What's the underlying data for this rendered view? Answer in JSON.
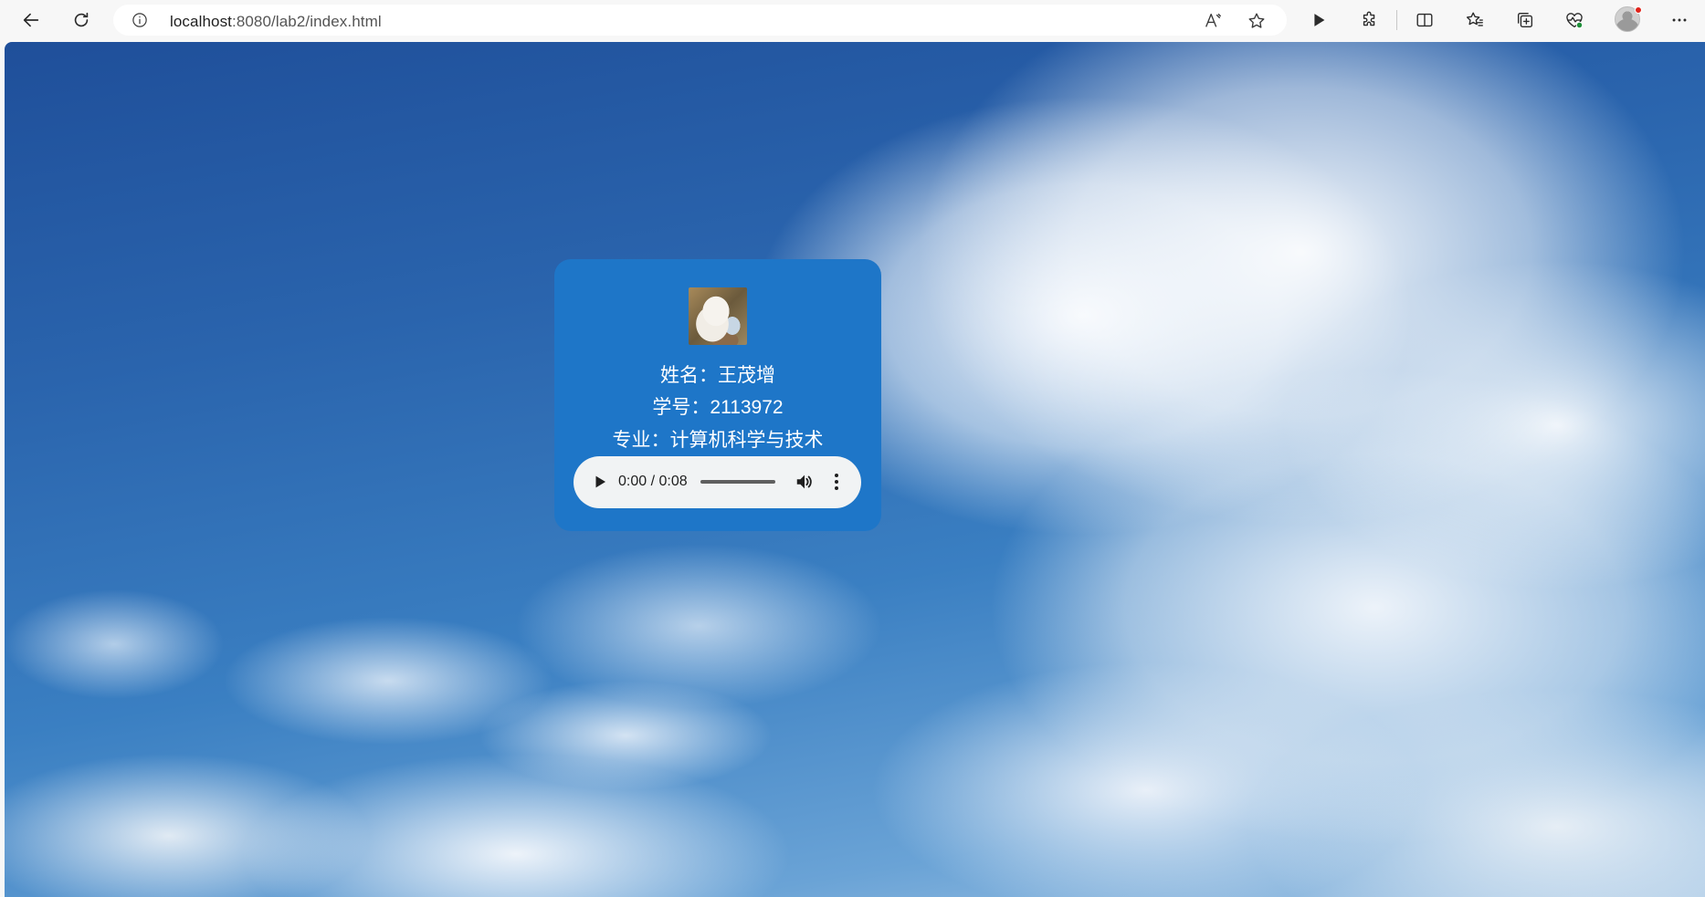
{
  "browser": {
    "url_host": "localhost",
    "url_rest": ":8080/lab2/index.html",
    "read_aloud_label": "A̅"
  },
  "profile": {
    "name_label": "姓名：王茂增",
    "id_label": "学号：2113972",
    "major_label": "专业：计算机科学与技术"
  },
  "audio": {
    "time": "0:00 / 0:08",
    "progress": 0
  },
  "colors": {
    "card_bg": "#1e76c8",
    "sky": "#2a64ad",
    "audio_bg": "#f1f3f4"
  }
}
